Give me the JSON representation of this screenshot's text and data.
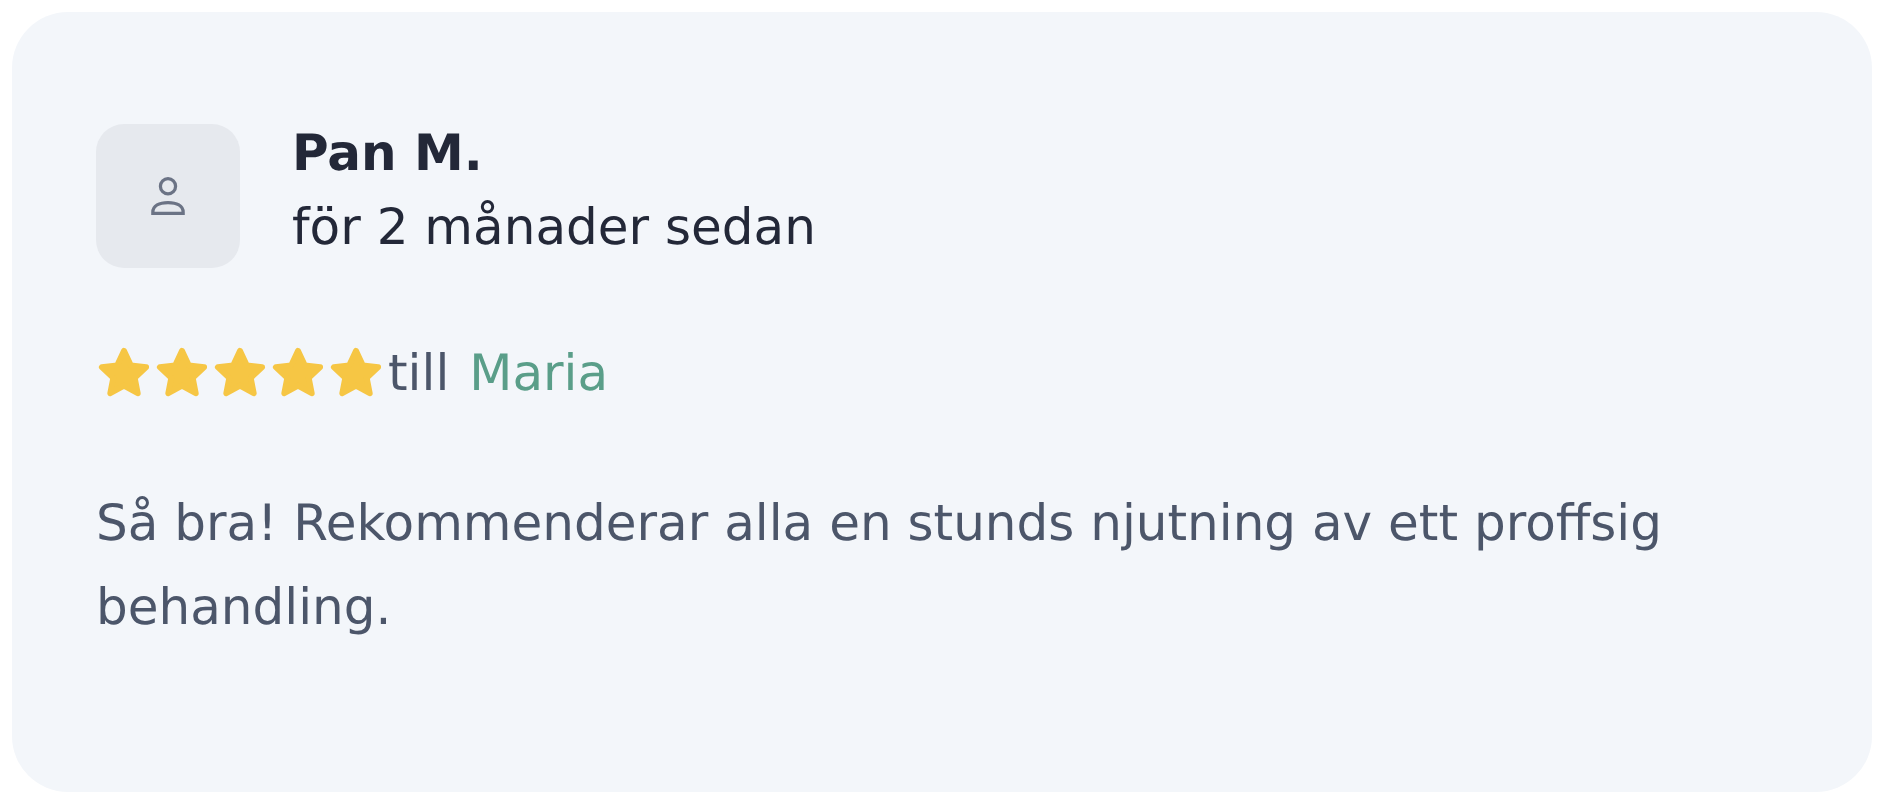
{
  "review": {
    "author": "Pan M.",
    "time": "för 2 månader sedan",
    "stars": 5,
    "to_label": "till",
    "staff": "Maria",
    "text": "Så bra! Rekommenderar alla en stunds njutning av ett proffsig behandling."
  }
}
